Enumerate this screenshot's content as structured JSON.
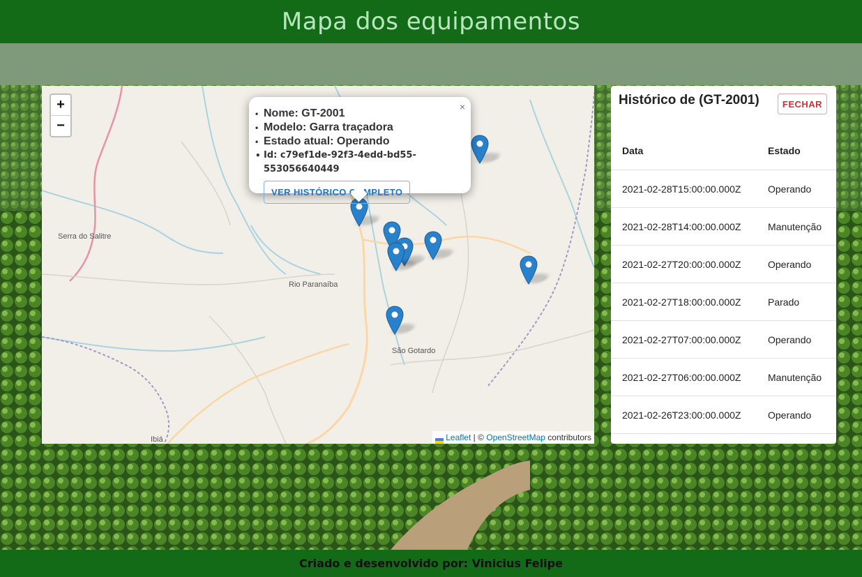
{
  "header": {
    "title": "Mapa dos equipamentos"
  },
  "footer": {
    "credit": "Criado e desenvolvido por: Vinicius Felipe"
  },
  "map": {
    "zoom_in": "+",
    "zoom_out": "−",
    "places": [
      "Serra do Salitre",
      "Rio Paranaíba",
      "São Gotardo",
      "Ibiá"
    ],
    "popup": {
      "name": "Nome: GT-2001",
      "model": "Modelo: Garra traçadora",
      "state": "Estado atual: Operando",
      "id": "Id: c79ef1de-92f3-4edd-bd55-553056640449",
      "button": "VER HISTÓRICO COMPLETO",
      "close": "×"
    },
    "attribution": {
      "leaflet": "Leaflet",
      "sep": " | © ",
      "osm": "OpenStreetMap",
      "suffix": " contributors"
    },
    "marker_color": "#2a81cb"
  },
  "history": {
    "title": "Histórico de (GT-2001)",
    "close_label": "FECHAR",
    "columns": [
      "Data",
      "Estado"
    ],
    "rows": [
      [
        "2021-02-28T15:00:00.000Z",
        "Operando"
      ],
      [
        "2021-02-28T14:00:00.000Z",
        "Manutenção"
      ],
      [
        "2021-02-27T20:00:00.000Z",
        "Operando"
      ],
      [
        "2021-02-27T18:00:00.000Z",
        "Parado"
      ],
      [
        "2021-02-27T07:00:00.000Z",
        "Operando"
      ],
      [
        "2021-02-27T06:00:00.000Z",
        "Manutenção"
      ],
      [
        "2021-02-26T23:00:00.000Z",
        "Operando"
      ]
    ]
  },
  "colors": {
    "header": "#146b17",
    "title": "#b9e6c0",
    "close_button": "#d32f2f",
    "link": "#1976d2"
  }
}
